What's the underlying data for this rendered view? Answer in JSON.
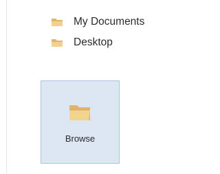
{
  "folders": [
    {
      "label": "My Documents",
      "icon": "folder-icon"
    },
    {
      "label": "Desktop",
      "icon": "folder-icon"
    }
  ],
  "browse": {
    "label": "Browse",
    "icon": "open-folder-icon"
  },
  "colors": {
    "folder_fill": "#e9c27b",
    "folder_front": "#f2d08e",
    "browse_bg": "#dde7f4",
    "browse_border": "#a9c3e4"
  }
}
